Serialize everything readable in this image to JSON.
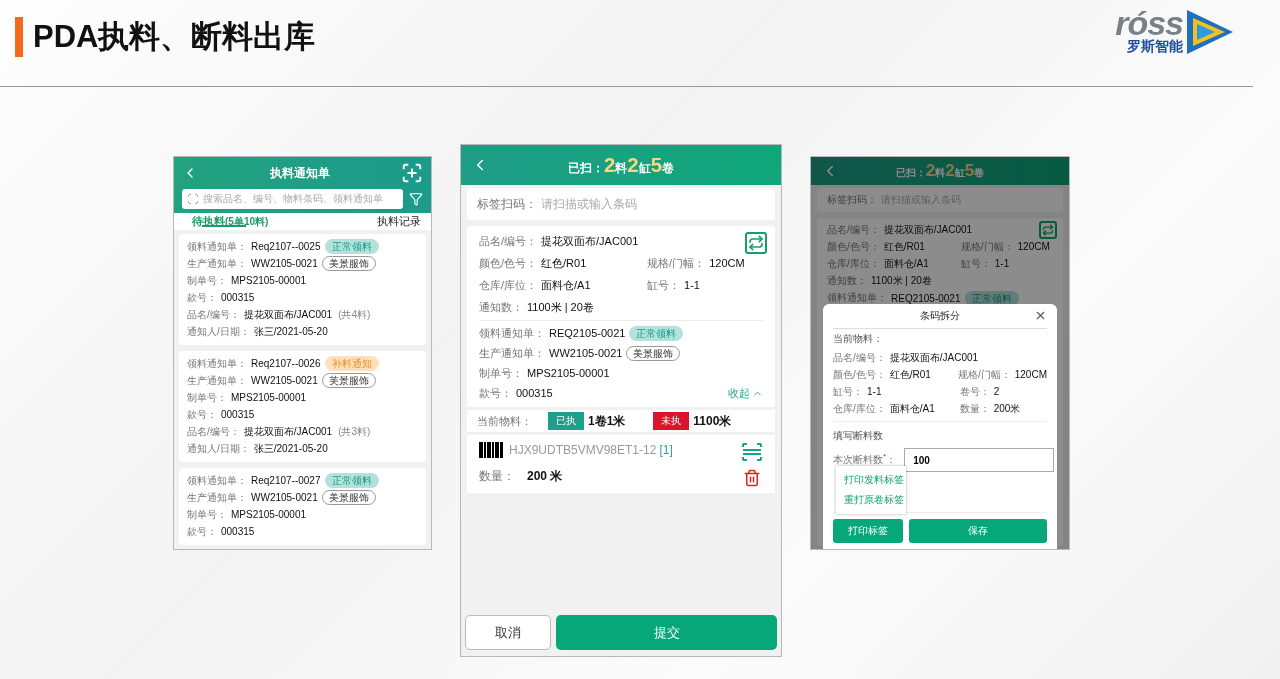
{
  "slide": {
    "title": "PDA执料、断料出库",
    "logo": {
      "wordmark": "róss",
      "tagline": "罗斯智能"
    }
  },
  "notice_list": {
    "title": "执料通知单",
    "search_placeholder": "搜索品名、编号、物料条码、领料通知单",
    "tabs": [
      {
        "label": "待执料",
        "note": "(5单10料)",
        "selected": true
      },
      {
        "label": "执料记录",
        "selected": false
      }
    ],
    "cards": [
      {
        "rows": [
          {
            "label": "领料通知单：",
            "value": "Req2107--0025",
            "tag": {
              "text": "正常领料",
              "kind": "normal"
            }
          },
          {
            "label": "生产通知单：",
            "value": "WW2105-0021",
            "tag": {
              "text": "美景服饰",
              "kind": "customer"
            }
          },
          {
            "label": "制单号：",
            "value": "MPS2105-00001"
          },
          {
            "label": "款号：",
            "value": "000315"
          },
          {
            "label": "品名/编号：",
            "value": "提花双面布/JAC001",
            "note": "(共4料)"
          },
          {
            "label": "通知人/日期：",
            "value": "张三/2021-05-20"
          }
        ]
      },
      {
        "rows": [
          {
            "label": "领料通知单：",
            "value": "Req2107--0026",
            "tag": {
              "text": "补料通知",
              "kind": "supplement"
            }
          },
          {
            "label": "生产通知单：",
            "value": "WW2105-0021",
            "tag": {
              "text": "芙景服饰",
              "kind": "customer"
            }
          },
          {
            "label": "制单号：",
            "value": "MPS2105-00001"
          },
          {
            "label": "款号：",
            "value": "000315"
          },
          {
            "label": "品名/编号：",
            "value": "提花双面布/JAC001",
            "note": "(共3料)"
          },
          {
            "label": "通知人/日期：",
            "value": "张三/2021-05-20"
          }
        ]
      },
      {
        "rows": [
          {
            "label": "领料通知单：",
            "value": "Req2107--0027",
            "tag": {
              "text": "正常领料",
              "kind": "normal"
            }
          },
          {
            "label": "生产通知单：",
            "value": "WW2105-0021",
            "tag": {
              "text": "美景服饰",
              "kind": "customer"
            }
          },
          {
            "label": "制单号：",
            "value": "MPS2105-00001"
          },
          {
            "label": "款号：",
            "value": "000315"
          }
        ]
      }
    ]
  },
  "scan_screen": {
    "title_parts": [
      {
        "text": "已扫：",
        "kind": "label"
      },
      {
        "text": "2",
        "kind": "count"
      },
      {
        "text": "料",
        "kind": "unit"
      },
      {
        "text": "2",
        "kind": "count"
      },
      {
        "text": "缸",
        "kind": "unit"
      },
      {
        "text": "5",
        "kind": "count"
      },
      {
        "text": "卷",
        "kind": "unit"
      }
    ],
    "scan_field": {
      "label": "标签扫码：",
      "placeholder": "请扫描或输入条码"
    },
    "material": {
      "rows": [
        [
          {
            "label": "品名/编号：",
            "value": "提花双面布/JAC001"
          }
        ],
        [
          {
            "label": "颜色/色号：",
            "value": "红色/R01"
          },
          {
            "label": "规格/门幅：",
            "value": "120CM"
          }
        ],
        [
          {
            "label": "仓库/库位：",
            "value": "面料仓/A1"
          },
          {
            "label": "缸号：",
            "value": "1-1"
          }
        ],
        [
          {
            "label": "通知数：",
            "value": "1100米 | 20卷"
          }
        ]
      ]
    },
    "notices": [
      {
        "label": "领料通知单：",
        "value": "REQ2105-0021",
        "tag": {
          "text": "正常领料",
          "kind": "normal"
        }
      },
      {
        "label": "生产通知单：",
        "value": "WW2105-0021",
        "tag": {
          "text": "美景服饰",
          "kind": "customer"
        }
      },
      {
        "label": "制单号：",
        "value": "MPS2105-00001"
      },
      {
        "label": "款号：",
        "value": "000315"
      }
    ],
    "collapse_link": "收起",
    "current": {
      "label": "当前物料：",
      "stats": [
        {
          "badge": "已执",
          "value": "1卷1米",
          "color": "#1e9f8c"
        },
        {
          "badge": "未执",
          "value": "1100米",
          "color": "#d9142b"
        }
      ]
    },
    "barcodes": [
      {
        "code": "HJX9UDTB5VMV98ET1-12",
        "count": "[1]",
        "qty_label": "数量：",
        "qty": "200 米"
      }
    ],
    "buttons": [
      {
        "label": "取消",
        "kind": "secondary"
      },
      {
        "label": "提交",
        "kind": "primary"
      }
    ]
  },
  "split_screen": {
    "title_parts": [
      {
        "text": "已扫：",
        "kind": "label"
      },
      {
        "text": "2",
        "kind": "count"
      },
      {
        "text": "料",
        "kind": "unit"
      },
      {
        "text": "2",
        "kind": "count"
      },
      {
        "text": "缸",
        "kind": "unit"
      },
      {
        "text": "5",
        "kind": "count"
      },
      {
        "text": "卷",
        "kind": "unit"
      }
    ],
    "scan_field": {
      "label": "标签扫码：",
      "placeholder": "请扫描或输入条码"
    },
    "material": {
      "rows": [
        [
          {
            "label": "品名/编号：",
            "value": "提花双面布/JAC001"
          }
        ],
        [
          {
            "label": "颜色/色号：",
            "value": "红色/R01"
          },
          {
            "label": "规格/门幅：",
            "value": "120CM"
          }
        ],
        [
          {
            "label": "仓库/库位：",
            "value": "面料仓/A1"
          },
          {
            "label": "缸号：",
            "value": "1-1"
          }
        ],
        [
          {
            "label": "通知数：",
            "value": "1100米 | 20卷"
          }
        ]
      ]
    },
    "notices": [
      {
        "label": "领料通知单：",
        "value": "REQ2105-0021",
        "tag": {
          "text": "正常领料",
          "kind": "normal"
        }
      }
    ],
    "dialog": {
      "title": "条码拆分",
      "section": "当前物料：",
      "rows": [
        [
          {
            "label": "品名/编号：",
            "value": "提花双面布/JAC001"
          }
        ],
        [
          {
            "label": "颜色/色号：",
            "value": "红色/R01"
          },
          {
            "label": "规格/门幅：",
            "value": "120CM"
          }
        ],
        [
          {
            "label": "缸号：",
            "value": "1-1"
          },
          {
            "label": "卷号：",
            "value": "2"
          }
        ],
        [
          {
            "label": "仓库/库位：",
            "value": "面料仓/A1"
          },
          {
            "label": "数量：",
            "value": "200米"
          }
        ]
      ],
      "input_section": "填写断料数",
      "input": {
        "label": "本次断料数$^{*}$：",
        "value": "100"
      },
      "menu": [
        "打印发料标签",
        "重打原卷标签"
      ],
      "buttons": [
        "打印标签",
        "保存"
      ]
    }
  }
}
